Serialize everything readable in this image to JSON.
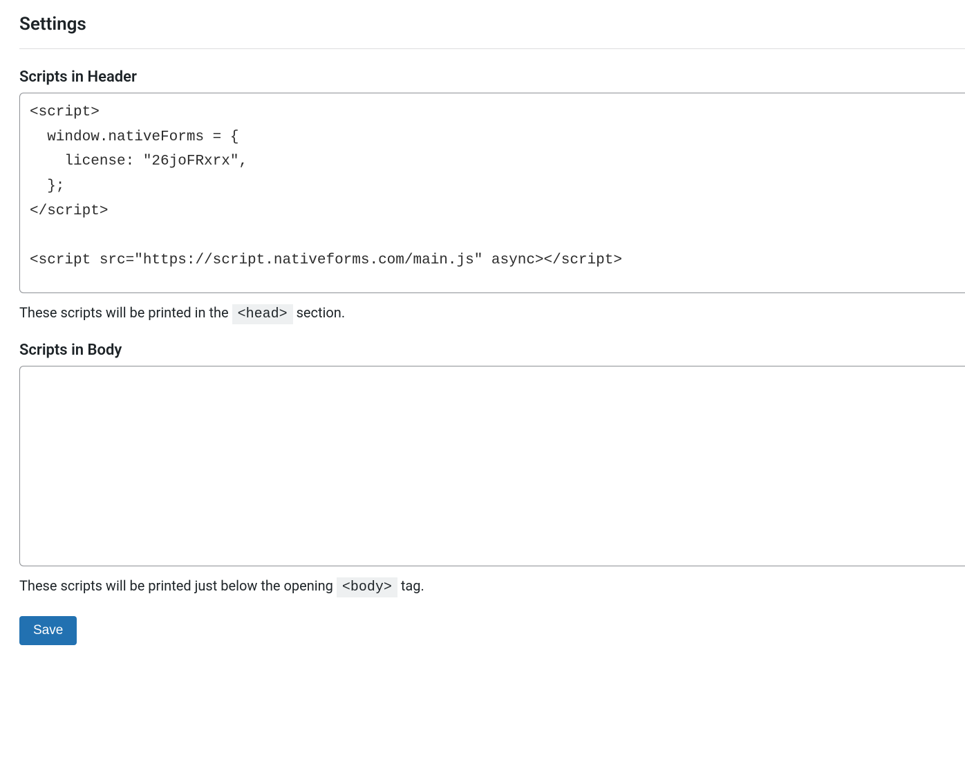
{
  "page_title": "Settings",
  "sections": {
    "header": {
      "label": "Scripts in Header",
      "value": "<script>\n  window.nativeForms = {\n    license: \"26joFRxrx\",\n  };\n</scr_ipt>\n\n<script src=\"https://script.nativeforms.com/main.js\" async></scr_ipt>",
      "help_before": "These scripts will be printed in the ",
      "help_code": "<head>",
      "help_after": " section."
    },
    "body": {
      "label": "Scripts in Body",
      "value": "",
      "help_before": "These scripts will be printed just below the opening ",
      "help_code": "<body>",
      "help_after": " tag."
    }
  },
  "buttons": {
    "save": "Save"
  }
}
